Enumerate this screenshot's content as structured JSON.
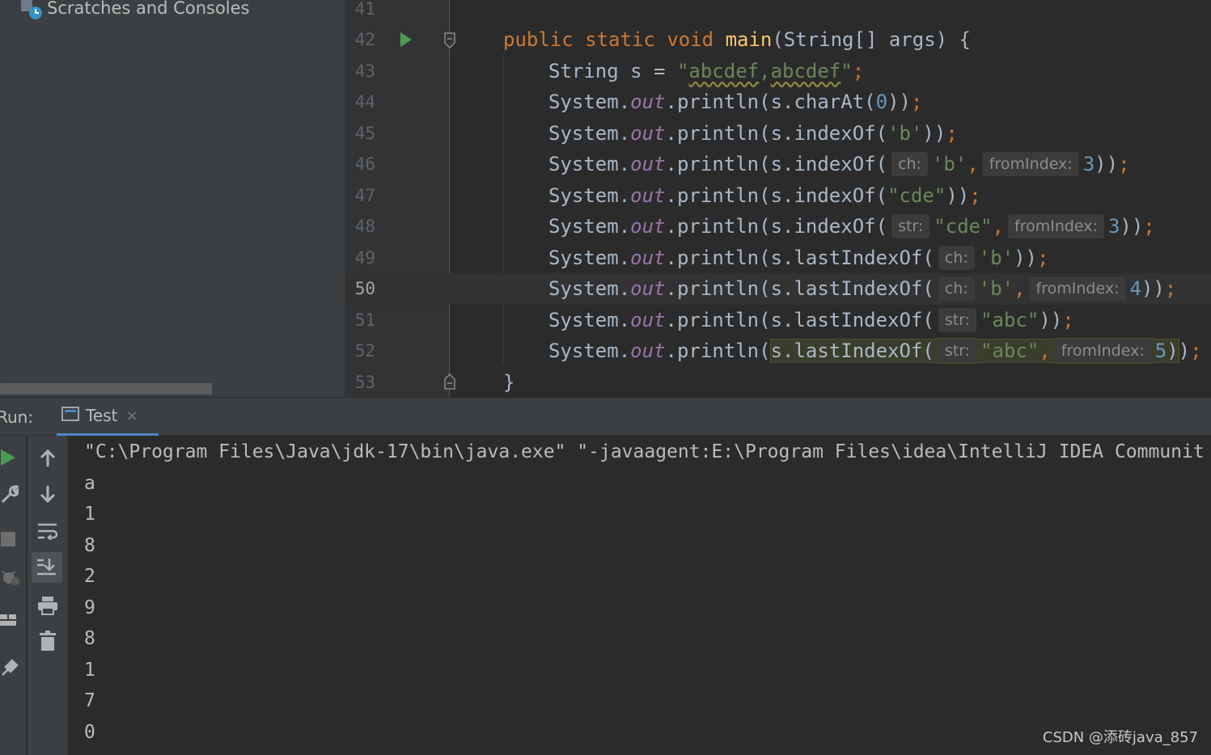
{
  "project_panel": {
    "scratches_label": "Scratches and Consoles"
  },
  "editor": {
    "current_line": 50,
    "line_numbers": [
      "41",
      "42",
      "43",
      "44",
      "45",
      "46",
      "47",
      "48",
      "49",
      "50",
      "51",
      "52",
      "53"
    ],
    "code": {
      "public_kw": "public",
      "static_kw": "static",
      "void_kw": "void",
      "main_fn": "main",
      "main_params": "(String[] args) {",
      "string_decl": "String s = ",
      "string_quote_open": "\"",
      "string_val_a": "abcdef",
      "string_comma": ",",
      "string_val_b": "abcdef",
      "string_quote_close": "\"",
      "semicolon": ";",
      "system": "System.",
      "out": "out",
      "println": ".println(",
      "closing_brace": "}",
      "l44_call": "s.charAt(",
      "l44_arg": "0",
      "l44_close": "))",
      "l45_call": "s.indexOf(",
      "l45_arg": "'b'",
      "l45_close": "))",
      "l46_call": "s.indexOf(",
      "l46_hint1": "ch:",
      "l46_arg1": "'b'",
      "l46_hint2": "fromIndex:",
      "l46_arg2": "3",
      "l46_close": "))",
      "l47_call": "s.indexOf(",
      "l47_arg": "\"cde\"",
      "l47_close": "))",
      "l48_call": "s.indexOf(",
      "l48_hint1": "str:",
      "l48_arg1": "\"cde\"",
      "l48_hint2": "fromIndex:",
      "l48_arg2": "3",
      "l48_close": "))",
      "l49_call": "s.lastIndexOf(",
      "l49_hint1": "ch:",
      "l49_arg1": "'b'",
      "l49_close": "))",
      "l50_call": "s.lastIndexOf(",
      "l50_hint1": "ch:",
      "l50_arg1": "'b'",
      "l50_hint2": "fromIndex:",
      "l50_arg2": "4",
      "l50_close": "))",
      "l51_call": "s.lastIndexOf(",
      "l51_hint1": "str:",
      "l51_arg1": "\"abc\"",
      "l51_close": "))",
      "l52_call": "s.lastIndexOf(",
      "l52_hint1": "str:",
      "l52_arg1": "\"abc\"",
      "l52_hint2": "fromIndex:",
      "l52_arg2": "5",
      "l52_close_hl": ")",
      "l52_close": ")"
    }
  },
  "run_panel": {
    "label": "Run:",
    "tab_label": "Test",
    "tab_close": "×"
  },
  "console": {
    "command": "\"C:\\Program Files\\Java\\jdk-17\\bin\\java.exe\" \"-javaagent:E:\\Program Files\\idea\\IntelliJ IDEA Communit",
    "output": [
      "a",
      "1",
      "8",
      "2",
      "9",
      "8",
      "1",
      "7",
      "0"
    ]
  },
  "watermark": "CSDN @添砖java_857",
  "colors": {
    "keyword": "#cc7832",
    "function": "#ffc66d",
    "string": "#6a8759",
    "number": "#6897bb",
    "field": "#9876aa",
    "run_green": "#499c54",
    "tab_underline": "#4a88c7"
  }
}
